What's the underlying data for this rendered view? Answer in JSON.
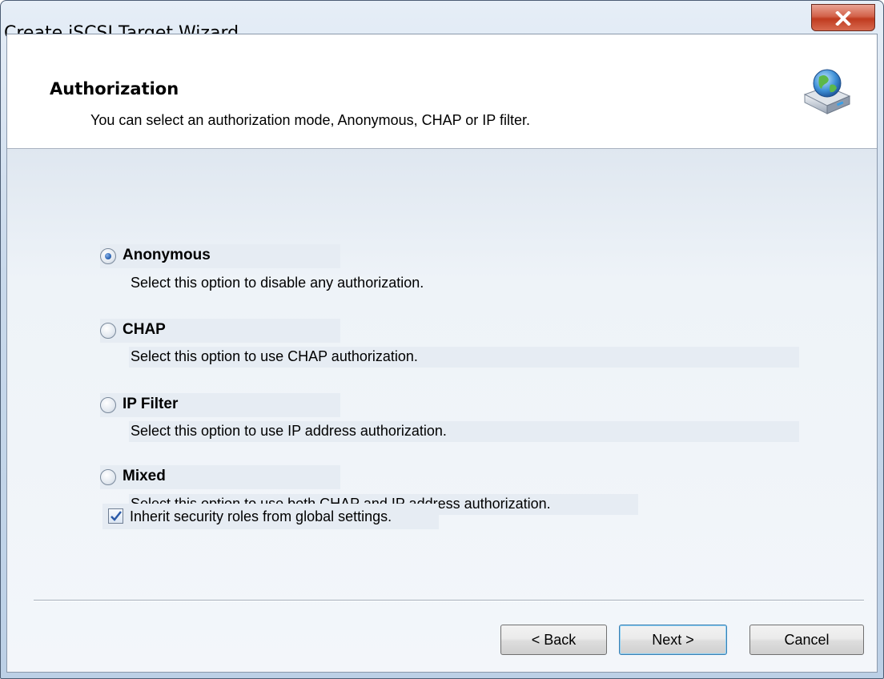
{
  "window": {
    "title": "Create iSCSI Target Wizard"
  },
  "header": {
    "title": "Authorization",
    "subtitle": "You can select an authorization mode, Anonymous, CHAP or IP filter."
  },
  "options": [
    {
      "label": "Anonymous",
      "description": "Select this option to disable any authorization.",
      "selected": true
    },
    {
      "label": "CHAP",
      "description": "Select this option to use CHAP authorization.",
      "selected": false
    },
    {
      "label": "IP Filter",
      "description": "Select this option to use IP address authorization.",
      "selected": false
    },
    {
      "label": "Mixed",
      "description": "Select this option to use both CHAP and IP address authorization.",
      "selected": false
    }
  ],
  "inherit": {
    "label": "Inherit security roles from global settings.",
    "checked": true
  },
  "buttons": {
    "back": "< Back",
    "next": "Next >",
    "cancel": "Cancel"
  },
  "colors": {
    "close_button": "#c9452a",
    "radio_selected": "#2f67b6",
    "check_mark": "#2a5aa8"
  },
  "icons": {
    "header": "network-drive-globe-icon",
    "close": "close-icon"
  }
}
